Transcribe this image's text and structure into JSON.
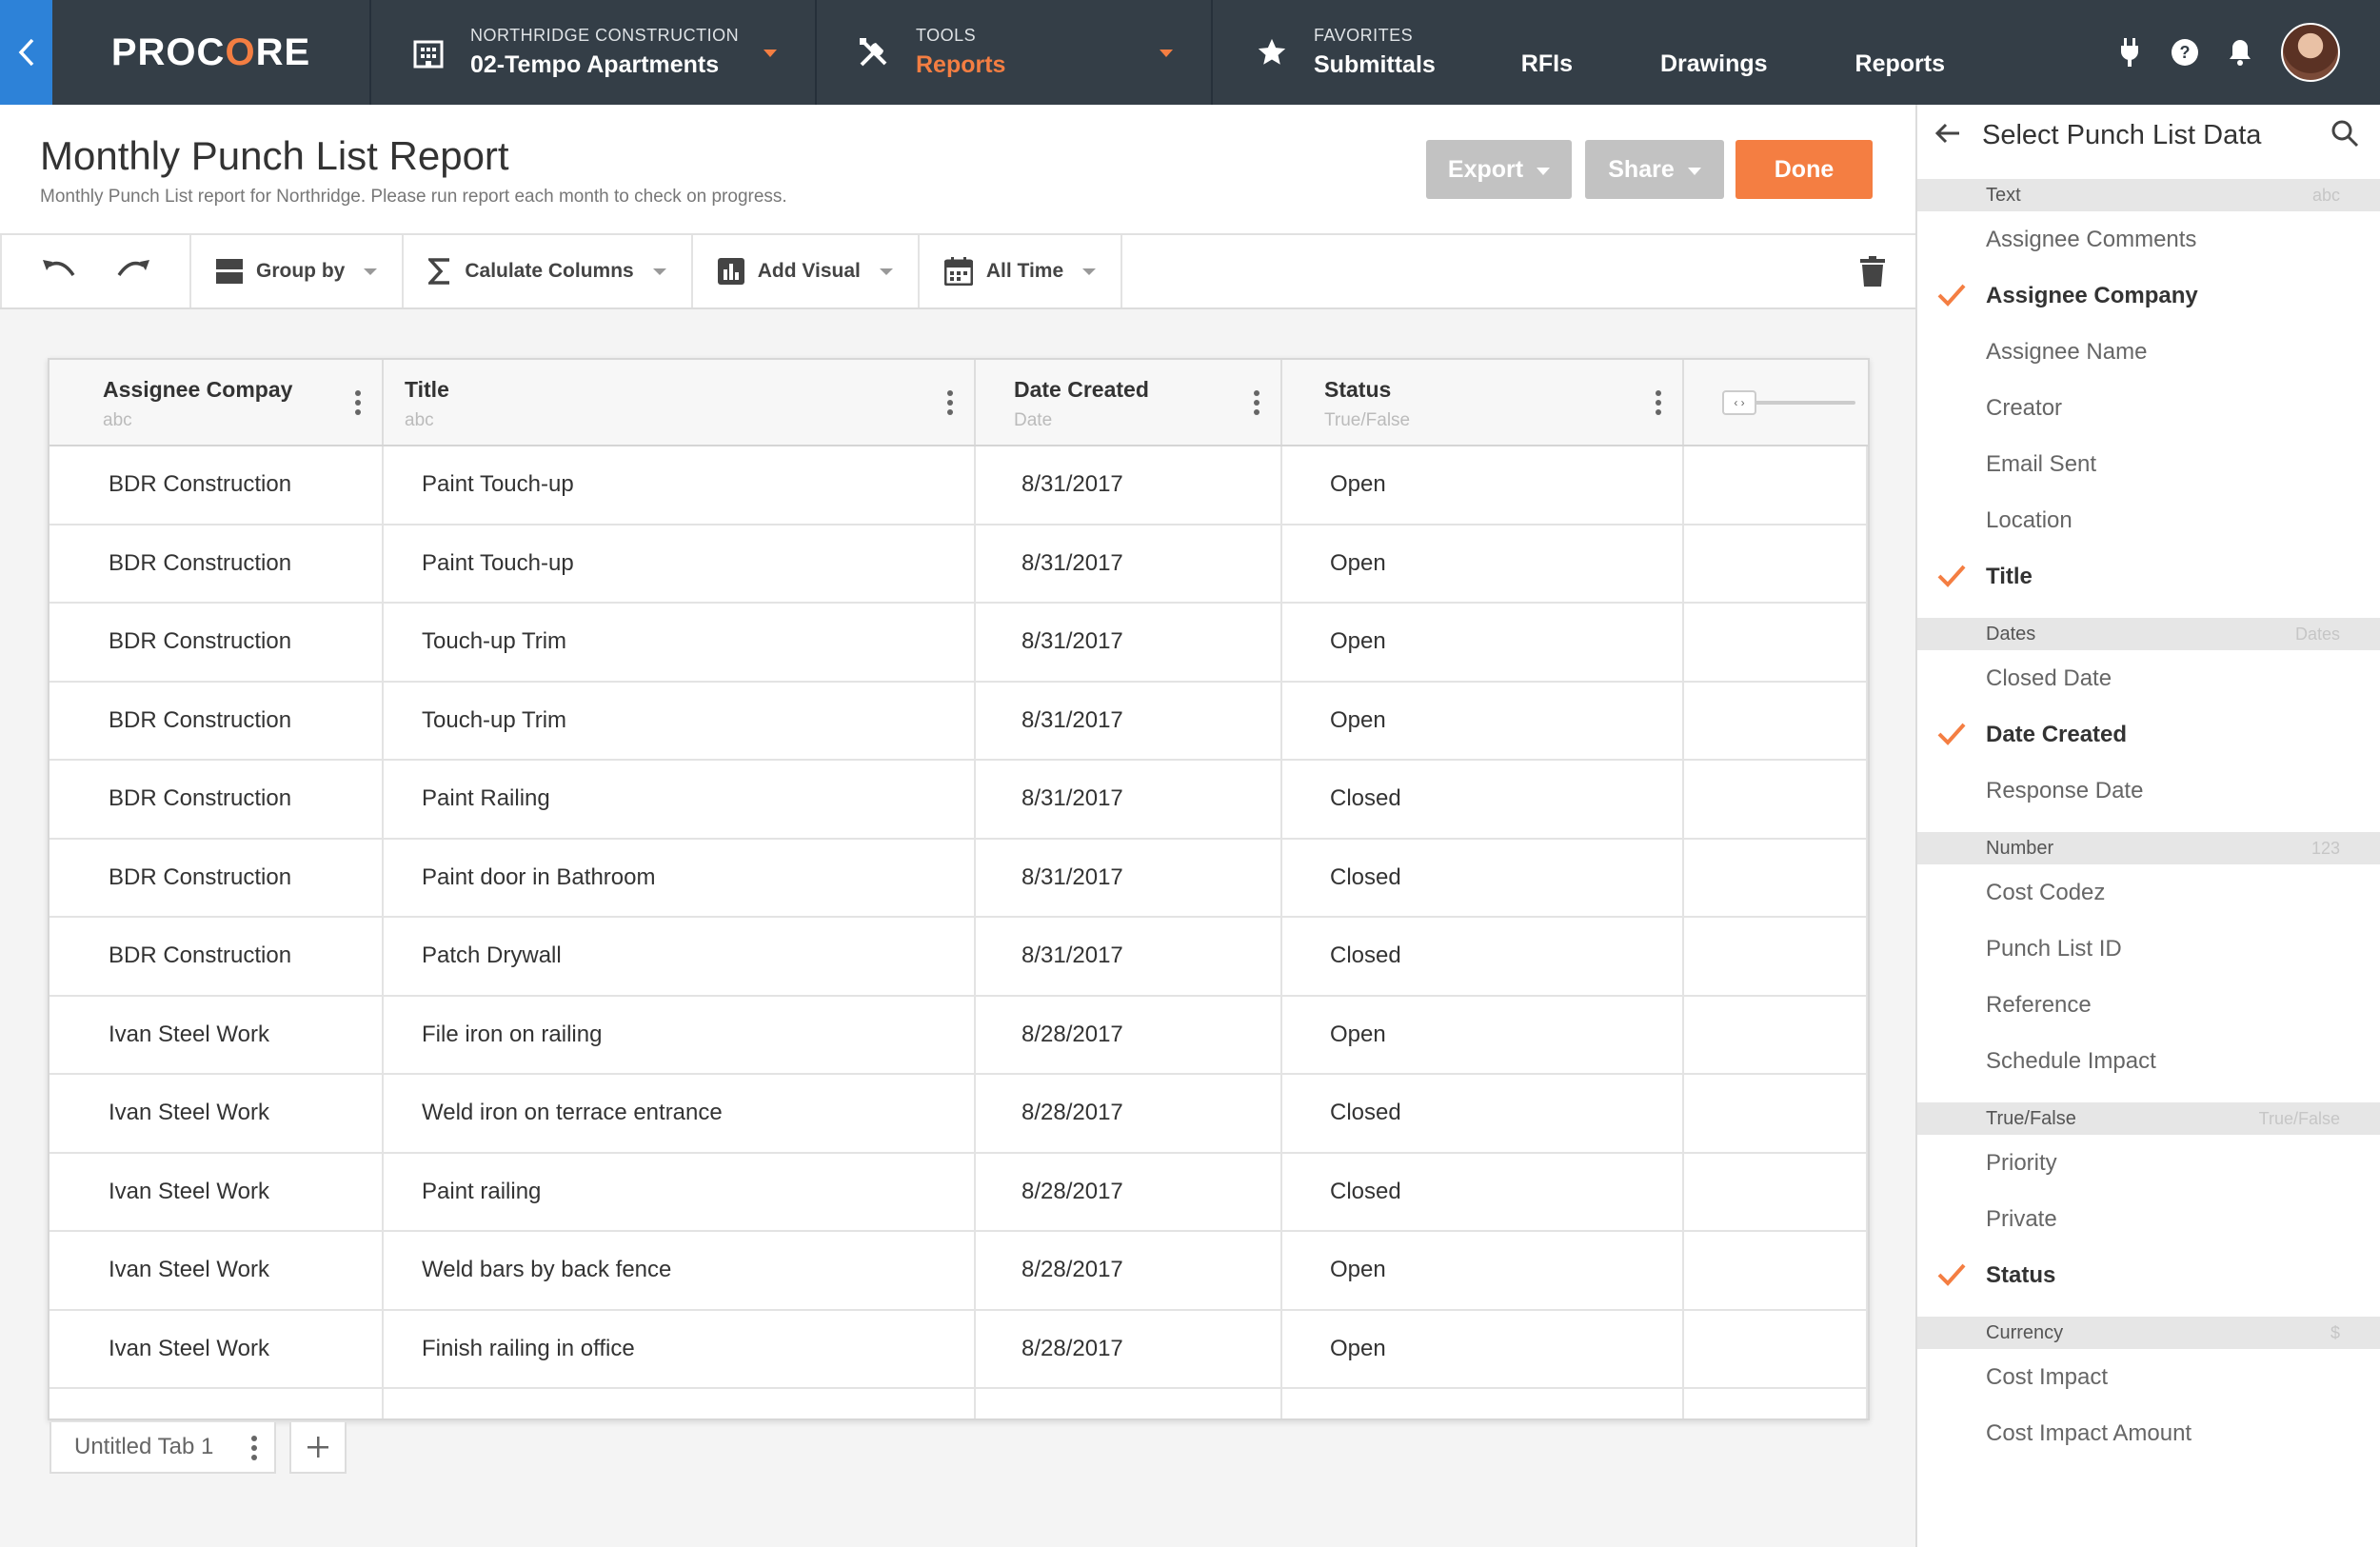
{
  "nav": {
    "logo": "PROCORE",
    "project_company": "NORTHRIDGE CONSTRUCTION",
    "project_name": "02-Tempo Apartments",
    "tools_label": "TOOLS",
    "tools_current": "Reports",
    "favorites_label": "FAVORITES",
    "favorites": [
      "Submittals",
      "RFIs",
      "Drawings",
      "Reports"
    ],
    "accent": "#f47e42",
    "back_color": "#2d82d8"
  },
  "header": {
    "title": "Monthly Punch List Report",
    "subtitle": "Monthly Punch List report for Northridge. Please run report each month to check  on progress.",
    "export_label": "Export",
    "share_label": "Share",
    "done_label": "Done"
  },
  "toolbar": {
    "group_by": "Group by",
    "calculate": "Calulate Columns",
    "add_visual": "Add Visual",
    "time_range": "All Time"
  },
  "table": {
    "columns": [
      {
        "title": "Assignee Compay",
        "type": "abc"
      },
      {
        "title": "Title",
        "type": "abc"
      },
      {
        "title": "Date Created",
        "type": "Date"
      },
      {
        "title": "Status",
        "type": "True/False"
      }
    ],
    "rows": [
      [
        "BDR Construction",
        "Paint Touch-up",
        "8/31/2017",
        "Open"
      ],
      [
        "BDR Construction",
        "Paint Touch-up",
        "8/31/2017",
        "Open"
      ],
      [
        "BDR Construction",
        "Touch-up Trim",
        "8/31/2017",
        "Open"
      ],
      [
        "BDR Construction",
        "Touch-up Trim",
        "8/31/2017",
        "Open"
      ],
      [
        "BDR Construction",
        "Paint Railing",
        "8/31/2017",
        "Closed"
      ],
      [
        "BDR Construction",
        "Paint door in Bathroom",
        "8/31/2017",
        "Closed"
      ],
      [
        "BDR Construction",
        "Patch Drywall",
        "8/31/2017",
        "Closed"
      ],
      [
        "Ivan Steel Work",
        "File iron on railing",
        "8/28/2017",
        "Open"
      ],
      [
        "Ivan Steel Work",
        "Weld iron on terrace entrance",
        "8/28/2017",
        "Closed"
      ],
      [
        "Ivan Steel Work",
        "Paint railing",
        "8/28/2017",
        "Closed"
      ],
      [
        "Ivan Steel Work",
        "Weld bars by back fence",
        "8/28/2017",
        "Open"
      ],
      [
        "Ivan Steel Work",
        "Finish railing in office",
        "8/28/2017",
        "Open"
      ]
    ],
    "slider_glyph": "‹ ›"
  },
  "tabs": {
    "items": [
      "Untitled Tab 1"
    ],
    "add_glyph": "+"
  },
  "panel": {
    "title": "Select Punch List Data",
    "sections": [
      {
        "name": "Text",
        "type": "abc",
        "items": [
          {
            "label": "Assignee Comments",
            "checked": false
          },
          {
            "label": "Assignee Company",
            "checked": true
          },
          {
            "label": "Assignee Name",
            "checked": false
          },
          {
            "label": "Creator",
            "checked": false
          },
          {
            "label": "Email Sent",
            "checked": false
          },
          {
            "label": "Location",
            "checked": false
          },
          {
            "label": "Title",
            "checked": true
          }
        ]
      },
      {
        "name": "Dates",
        "type": "Dates",
        "items": [
          {
            "label": "Closed Date",
            "checked": false
          },
          {
            "label": "Date Created",
            "checked": true
          },
          {
            "label": "Response Date",
            "checked": false
          }
        ]
      },
      {
        "name": "Number",
        "type": "123",
        "items": [
          {
            "label": "Cost Codez",
            "checked": false
          },
          {
            "label": "Punch List ID",
            "checked": false
          },
          {
            "label": "Reference",
            "checked": false
          },
          {
            "label": "Schedule Impact",
            "checked": false
          }
        ]
      },
      {
        "name": "True/False",
        "type": "True/False",
        "items": [
          {
            "label": "Priority",
            "checked": false
          },
          {
            "label": "Private",
            "checked": false
          },
          {
            "label": "Status",
            "checked": true
          }
        ]
      },
      {
        "name": "Currency",
        "type": "$",
        "items": [
          {
            "label": "Cost Impact",
            "checked": false
          },
          {
            "label": "Cost Impact Amount",
            "checked": false
          }
        ]
      }
    ]
  }
}
